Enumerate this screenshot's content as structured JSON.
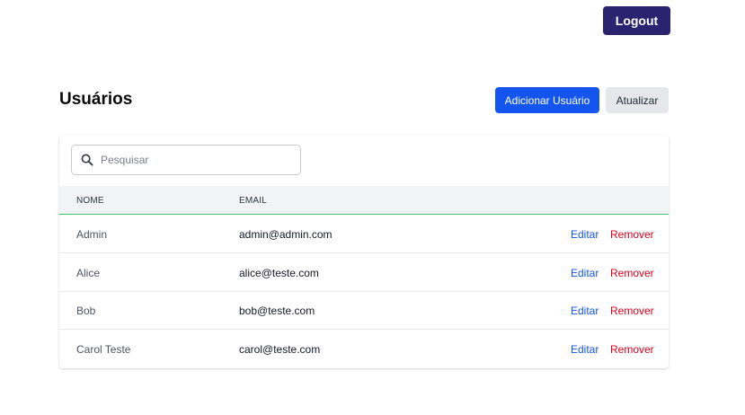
{
  "header": {
    "logout_label": "Logout"
  },
  "page": {
    "title": "Usuários",
    "add_user_label": "Adicionar Usuário",
    "refresh_label": "Atualizar"
  },
  "search": {
    "placeholder": "Pesquisar",
    "value": ""
  },
  "table": {
    "columns": [
      "NOME",
      "EMAIL"
    ],
    "rows": [
      {
        "name": "Admin",
        "email": "admin@admin.com",
        "edit": "Editar",
        "remove": "Remover"
      },
      {
        "name": "Alice",
        "email": "alice@teste.com",
        "edit": "Editar",
        "remove": "Remover"
      },
      {
        "name": "Bob",
        "email": "bob@teste.com",
        "edit": "Editar",
        "remove": "Remover"
      },
      {
        "name": "Carol Teste",
        "email": "carol@teste.com",
        "edit": "Editar",
        "remove": "Remover"
      }
    ]
  },
  "colors": {
    "logout_bg": "#2a2370",
    "primary": "#1455f0",
    "danger": "#e0001b",
    "header_accent": "#3ec46d"
  },
  "icons": {
    "search": "search-icon"
  }
}
